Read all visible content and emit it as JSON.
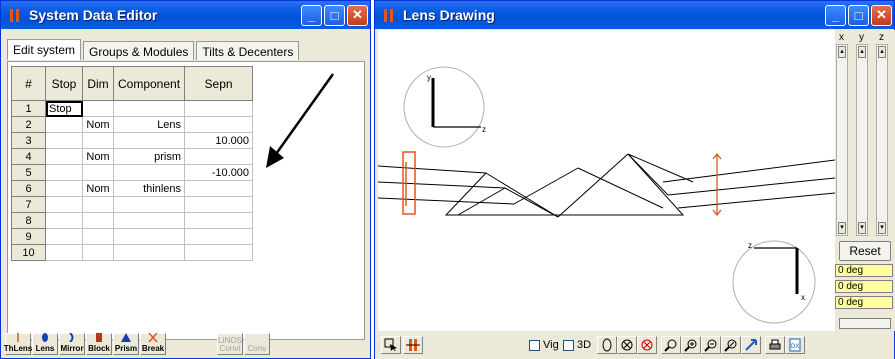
{
  "editor": {
    "title": "System Data Editor",
    "tabs": [
      {
        "label": "Edit system"
      },
      {
        "label": "Groups & Modules"
      },
      {
        "label": "Tilts & Decenters"
      }
    ],
    "columns": [
      "#",
      "Stop",
      "Dim",
      "Component",
      "Sepn"
    ],
    "rows": [
      {
        "num": "1",
        "stop": "Stop",
        "dim": "",
        "component": "",
        "sepn": ""
      },
      {
        "num": "2",
        "stop": "",
        "dim": "Nom",
        "component": "Lens",
        "sepn": ""
      },
      {
        "num": "3",
        "stop": "",
        "dim": "",
        "component": "",
        "sepn": "10.000"
      },
      {
        "num": "4",
        "stop": "",
        "dim": "Nom",
        "component": "prism",
        "sepn": ""
      },
      {
        "num": "5",
        "stop": "",
        "dim": "",
        "component": "",
        "sepn": "-10.000"
      },
      {
        "num": "6",
        "stop": "",
        "dim": "Nom",
        "component": "thinlens",
        "sepn": ""
      },
      {
        "num": "7",
        "stop": "",
        "dim": "",
        "component": "",
        "sepn": ""
      },
      {
        "num": "8",
        "stop": "",
        "dim": "",
        "component": "",
        "sepn": ""
      },
      {
        "num": "9",
        "stop": "",
        "dim": "",
        "component": "",
        "sepn": ""
      },
      {
        "num": "10",
        "stop": "",
        "dim": "",
        "component": "",
        "sepn": ""
      }
    ],
    "toolbar": [
      {
        "label": "ThLens",
        "icon": "thinlens-icon",
        "enabled": true
      },
      {
        "label": "Lens",
        "icon": "lens-icon",
        "enabled": true
      },
      {
        "label": "Mirror",
        "icon": "mirror-icon",
        "enabled": true
      },
      {
        "label": "Block",
        "icon": "block-icon",
        "enabled": true
      },
      {
        "label": "Prism",
        "icon": "prism-icon",
        "enabled": true
      },
      {
        "label": "Break",
        "icon": "break-icon",
        "enabled": true
      },
      {
        "label": "LINOS\nConvt",
        "icon": "linos-convert-icon",
        "enabled": false
      },
      {
        "label": "Conv",
        "icon": "spindler-convert-icon",
        "enabled": false
      }
    ]
  },
  "drawing": {
    "title": "Lens Drawing",
    "axis_labels": {
      "x": "x",
      "y": "y",
      "z": "z"
    },
    "axes_top": {
      "vertical": "y",
      "horizontal": "z"
    },
    "axes_bottom": {
      "horizontal": "z",
      "vertical": "x"
    },
    "reset_label": "Reset",
    "angles": [
      "0 deg",
      "0 deg",
      "0 deg"
    ],
    "bottom_toolbar": {
      "vig_label": "Vig",
      "threed_label": "3D"
    },
    "colors": {
      "element": "#E2561A",
      "rays": "#000000"
    }
  }
}
